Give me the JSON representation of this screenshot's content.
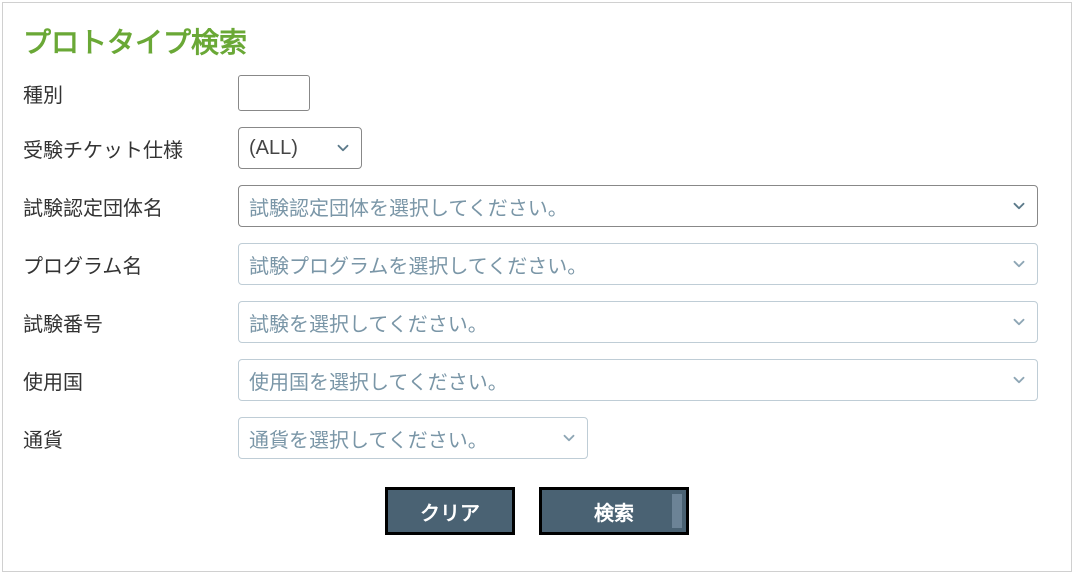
{
  "title": "プロトタイプ検索",
  "fields": {
    "type": {
      "label": "種別",
      "value": ""
    },
    "ticketSpec": {
      "label": "受験チケット仕様",
      "value": "(ALL)"
    },
    "sponsor": {
      "label": "試験認定団体名",
      "placeholder": "試験認定団体を選択してください。"
    },
    "program": {
      "label": "プログラム名",
      "placeholder": "試験プログラムを選択してください。"
    },
    "examNumber": {
      "label": "試験番号",
      "placeholder": "試験を選択してください。"
    },
    "country": {
      "label": "使用国",
      "placeholder": "使用国を選択してください。"
    },
    "currency": {
      "label": "通貨",
      "placeholder": "通貨を選択してください。"
    }
  },
  "buttons": {
    "clear": "クリア",
    "search": "検索"
  }
}
